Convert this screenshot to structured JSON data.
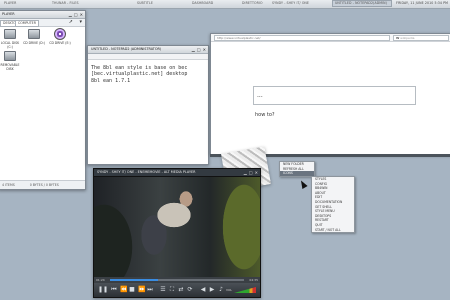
{
  "taskbar": {
    "items": [
      "PLAYER",
      "THUNAR - FILES",
      "SUBTITLE",
      "DASHBOARD",
      "DIRETTORIO",
      "SYNDY - SHEY IT/ ONE",
      "UNTITLED - NOTEPAD2(ADMIN)"
    ],
    "clock": "FRIDAY, 11 JUNE 2010 5:34 PM"
  },
  "file_manager": {
    "title": "PLAYER",
    "tab": "DESKTOP",
    "tab2": "COMPUTER",
    "items": [
      {
        "label": "LOCAL DISK (C:)",
        "icon": "hard-disk-icon"
      },
      {
        "label": "CD DRIVE (D:)",
        "icon": "cd-drive-icon"
      },
      {
        "label": "CD DRIVE (E:)",
        "icon": "dvd-disc-icon"
      },
      {
        "label": "REMOVABLE DISK",
        "icon": "removable-disk-icon"
      }
    ],
    "status_left": "4 ITEMS",
    "status_right": "0 BYTES / 0 BYTES"
  },
  "notepad": {
    "title": "UNTITLED - NOTEPAD2 (ADMINISTRATOR)",
    "lines": [
      "The 8bl ean style is base on bec",
      "[bec.virtualplastic.net] desktop",
      "8bl ean 1.7.1"
    ]
  },
  "browser": {
    "url": "http://www.virtualplastic.net/",
    "search_text": "W",
    "search_placeholder": "wikipedia",
    "input_value": "...",
    "body_text": "how to?"
  },
  "video_player": {
    "title": "SYNDY - SHEY IT/ ONE - ENEMEMOVIE - ALT MEDIA PLAYER",
    "time_elapsed": "01:24",
    "time_total": "04:35",
    "progress": 0.36,
    "volume_label": "VOL"
  },
  "menus": {
    "menu1": [
      "NEW FOLDER",
      "REFRESH ALL",
      "ICONS"
    ],
    "menu2": [
      "STYLES",
      "CONFIG",
      "BB4WIN",
      "ABOUT",
      "EDIT",
      "DOCUMENTATION",
      "GET SHELL",
      "STYLE MENU",
      "DESKTOPS",
      "RESTART",
      "QUIT",
      "START / NOT ALL"
    ]
  },
  "colors": {
    "desktop": "#a6b4c2",
    "accent": "#3a8ce0"
  }
}
